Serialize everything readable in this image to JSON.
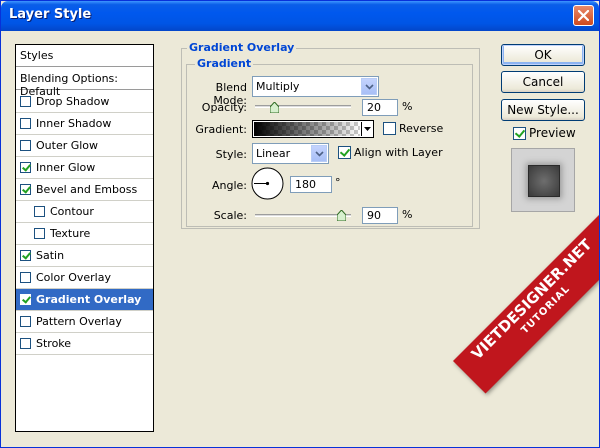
{
  "window": {
    "title": "Layer Style"
  },
  "styles_list": {
    "header": "Styles",
    "blending": "Blending Options: Default",
    "items": [
      {
        "label": "Drop Shadow",
        "checked": false,
        "indent": false
      },
      {
        "label": "Inner Shadow",
        "checked": false,
        "indent": false
      },
      {
        "label": "Outer Glow",
        "checked": false,
        "indent": false
      },
      {
        "label": "Inner Glow",
        "checked": true,
        "indent": false
      },
      {
        "label": "Bevel and Emboss",
        "checked": true,
        "indent": false
      },
      {
        "label": "Contour",
        "checked": false,
        "indent": true
      },
      {
        "label": "Texture",
        "checked": false,
        "indent": true
      },
      {
        "label": "Satin",
        "checked": true,
        "indent": false
      },
      {
        "label": "Color Overlay",
        "checked": false,
        "indent": false
      },
      {
        "label": "Gradient Overlay",
        "checked": true,
        "indent": false,
        "selected": true
      },
      {
        "label": "Pattern Overlay",
        "checked": false,
        "indent": false
      },
      {
        "label": "Stroke",
        "checked": false,
        "indent": false
      }
    ]
  },
  "panel": {
    "title": "Gradient Overlay",
    "group_title": "Gradient",
    "blend_mode_label": "Blend Mode:",
    "blend_mode_value": "Multiply",
    "opacity_label": "Opacity:",
    "opacity_value": "20",
    "opacity_unit": "%",
    "opacity_level": 0.2,
    "gradient_label": "Gradient:",
    "reverse_label": "Reverse",
    "reverse_checked": false,
    "style_label": "Style:",
    "style_value": "Linear",
    "align_label": "Align with Layer",
    "align_checked": true,
    "angle_label": "Angle:",
    "angle_value": "180",
    "angle_unit": "°",
    "scale_label": "Scale:",
    "scale_value": "90",
    "scale_unit": "%",
    "scale_level": 0.9
  },
  "buttons": {
    "ok": "OK",
    "cancel": "Cancel",
    "new_style": "New Style...",
    "preview_label": "Preview",
    "preview_checked": true
  },
  "watermark": {
    "main": "VIETDESIGNER.NET",
    "sub": "TUTORIAL"
  },
  "colors": {
    "title_bar": "#0058ee",
    "selection": "#316ac5",
    "group_title": "#0046d5",
    "watermark": "#c0161d"
  }
}
